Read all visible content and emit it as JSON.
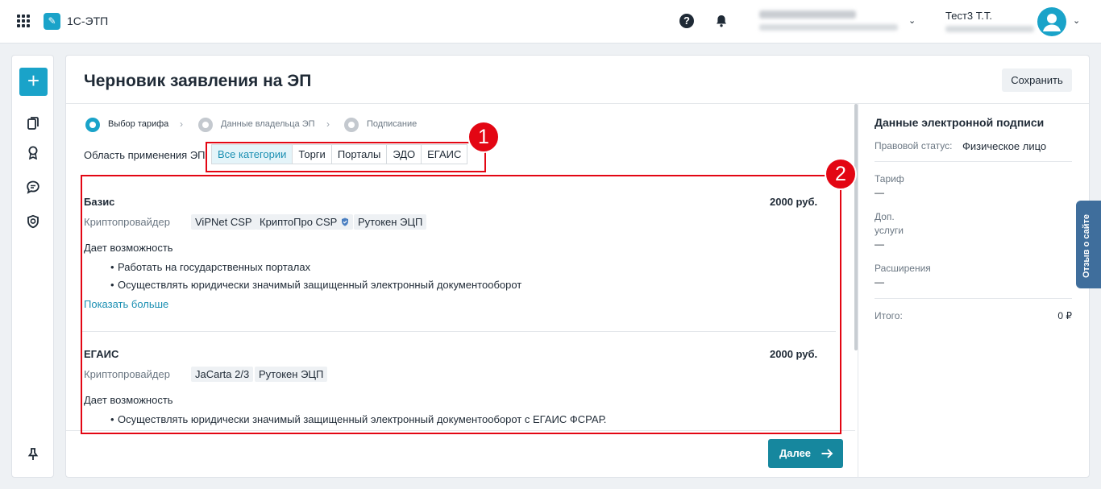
{
  "header": {
    "brand": "1С-ЭТП",
    "user_name": "Тест3 Т.Т."
  },
  "page": {
    "title": "Черновик заявления на ЭП",
    "save_label": "Сохранить"
  },
  "steps": [
    {
      "label": "Выбор тарифа",
      "state": "active"
    },
    {
      "label": "Данные владельца ЭП",
      "state": "idle"
    },
    {
      "label": "Подписание",
      "state": "idle"
    }
  ],
  "scope": {
    "label": "Область применения ЭП:",
    "filters": [
      "Все категории",
      "Торги",
      "Порталы",
      "ЭДО",
      "ЕГАИС"
    ],
    "selected": "Все категории"
  },
  "callouts": [
    "1",
    "2"
  ],
  "tariffs": [
    {
      "name": "Базис",
      "price": "2000 руб.",
      "crypto_label": "Криптопровайдер",
      "providers": [
        "ViPNet CSP",
        "КриптоПро CSP",
        "Рутокен ЭЦП"
      ],
      "can_label": "Дает возможность",
      "features": [
        "Работать на государственных порталах",
        "Осуществлять юридически значимый защищенный электронный документооборот"
      ],
      "more_label": "Показать больше"
    },
    {
      "name": "ЕГАИС",
      "price": "2000 руб.",
      "crypto_label": "Криптопровайдер",
      "providers": [
        "JaCarta 2/3",
        "Рутокен ЭЦП"
      ],
      "can_label": "Дает возможность",
      "features": [
        "Осуществлять юридически значимый защищенный электронный документооборот с ЕГАИС ФСРАР."
      ]
    }
  ],
  "next_label": "Далее",
  "summary": {
    "title": "Данные электронной подписи",
    "legal_status_label": "Правовой статус:",
    "legal_status_value": "Физическое лицо",
    "tariff_label": "Тариф",
    "tariff_value": "—",
    "extra_label_1": "Доп.",
    "extra_label_2": "услуги",
    "extra_value": "—",
    "ext_label": "Расширения",
    "ext_value": "—",
    "total_label": "Итого:",
    "total_value": "0 ₽"
  },
  "feedback_label": "Отзыв о сайте",
  "colors": {
    "accent": "#1aa3c9",
    "primary_button": "#16879e",
    "callout": "#e30613",
    "feedback_tab": "#3f6e9c"
  }
}
